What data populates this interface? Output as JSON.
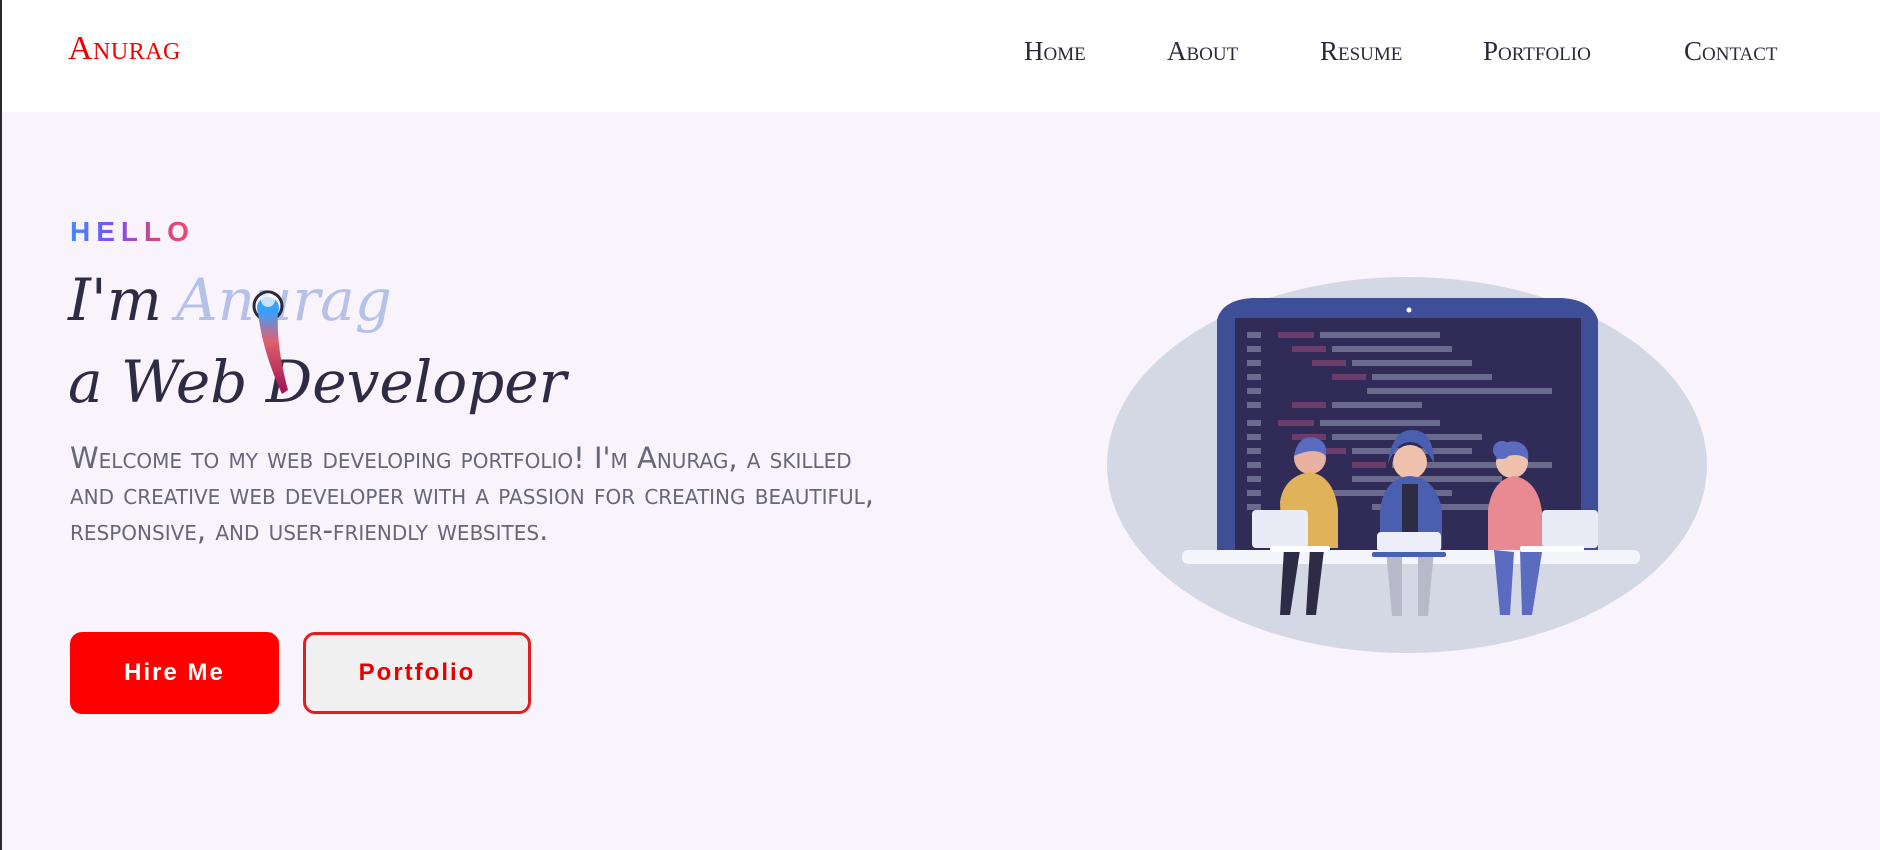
{
  "header": {
    "logo": "Anurag",
    "nav": [
      "Home",
      "About",
      "Resume",
      "Portfolio",
      "Contact"
    ]
  },
  "hero": {
    "greeting": "HELLO",
    "im": "I'm",
    "name": "Anurag",
    "role": "a Web Developer",
    "intro": "Welcome to my web developing portfolio! I'm Anurag, a skilled and creative web developer with a passion for creating beautiful, responsive, and user-friendly websites.",
    "hire_label": "Hire Me",
    "portfolio_label": "Portfolio"
  },
  "colors": {
    "accent": "#ff0000",
    "background": "#f9f3fc",
    "text_dark": "#2e2b45"
  },
  "illustration": {
    "description_icon": "developers-laptop-illustration"
  }
}
